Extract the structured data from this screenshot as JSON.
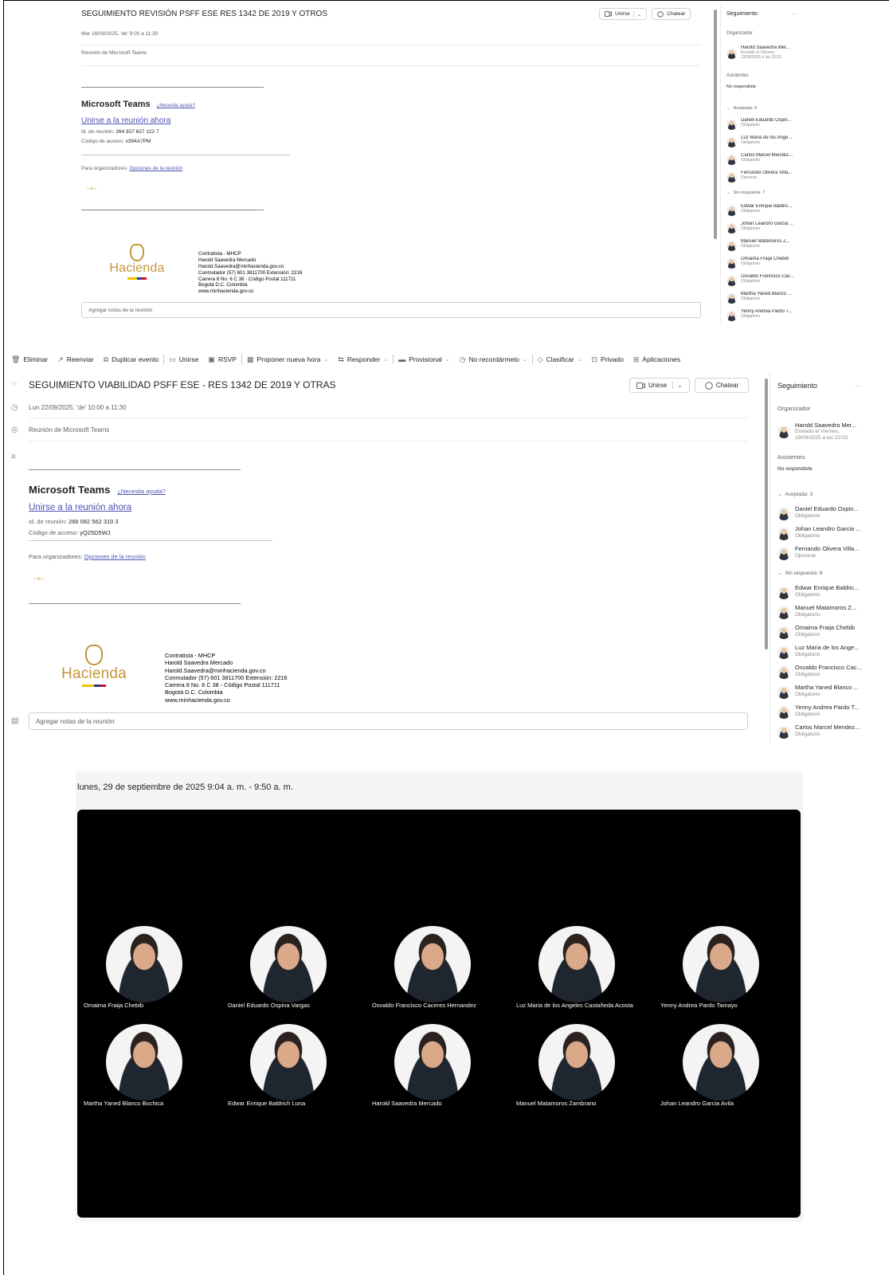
{
  "panel1": {
    "title": "SEGUIMIENTO REVISIÓN PSFF ESE RES 1342 DE 2019 Y OTROS",
    "date": "Mar 16/09/2025, 'de' 9:00 a 11:30",
    "location": "Reunión de Microsoft Teams",
    "join_label": "Unirse",
    "chat_label": "Chatear",
    "teams_heading": "Microsoft Teams",
    "help_link": "¿Necesita ayuda?",
    "join_now": "Unirse a la reunión ahora",
    "meeting_id_label": "Id. de reunión: ",
    "meeting_id": "264 927 627 122 7",
    "passcode_label": "Código de acceso: ",
    "passcode": "x394A7PM",
    "organizers_label": "Para organizadores: ",
    "options_link": "Opciones de la reunión",
    "notes_placeholder": "Agregar notas de la reunión",
    "side": {
      "title": "Seguimiento",
      "more": "···",
      "organizer_label": "Organizador",
      "organizer_name": "Harold Saavedra Mer...",
      "organizer_sent_1": "Enviado el Viernes,",
      "organizer_sent_2": "12/09/2025 a las 22:51",
      "attendees_label": "Asistentes",
      "no_response": "No respondiste",
      "accepted_label": "Aceptada: 4",
      "accepted": [
        {
          "name": "Daniel Eduardo Ospin...",
          "role": "Obligatorio"
        },
        {
          "name": "Luz Maria de los Ange...",
          "role": "Obligatorio"
        },
        {
          "name": "Carlos Marcel Mendez...",
          "role": "Obligatorio"
        },
        {
          "name": "Fernando Olivera Villa...",
          "role": "Opcional"
        }
      ],
      "noreply_label": "Sin respuesta: 7",
      "noreply": [
        {
          "name": "Edwar Enrique Baldric...",
          "role": "Obligatorio"
        },
        {
          "name": "Johan Leandro Garcia ...",
          "role": "Obligatorio"
        },
        {
          "name": "Manuel Matamoros Z...",
          "role": "Obligatorio"
        },
        {
          "name": "Omaima Fraija Chebib",
          "role": "Obligatorio"
        },
        {
          "name": "Osvaldo Francisco Cac...",
          "role": "Obligatorio"
        },
        {
          "name": "Martha Yaned Blanco ...",
          "role": "Obligatorio"
        },
        {
          "name": "Yenny Andrea Pardo T...",
          "role": "Obligatorio"
        }
      ]
    }
  },
  "signature": {
    "logo_text": "Hacienda",
    "lines": [
      "Contratista - MHCP",
      "Harold Saavedra Mercado",
      "Harold.Saavedra@minhacienda.gov.co",
      "Conmutador (57) 601 3811700 Extensión: 2216",
      "Carrera 8 No. 6 C 38 - Código Postal 111711",
      "Bogotá D.C. Colombia",
      "www.minhacienda.gov.co"
    ],
    "flag_colors": [
      "#f2c200",
      "#1c3f94",
      "#d0102a"
    ],
    "gold": "#c4953b"
  },
  "toolbar": {
    "items": [
      {
        "label": "Eliminar",
        "icon": "trash-icon",
        "chevron": false
      },
      {
        "label": "Reenviar",
        "icon": "forward-icon",
        "chevron": false
      },
      {
        "label": "Duplicar evento",
        "icon": "duplicate-icon",
        "chevron": false
      },
      {
        "label": "Unirse",
        "icon": "video-icon",
        "chevron": false
      },
      {
        "label": "RSVP",
        "icon": "rsvp-icon",
        "chevron": false
      },
      {
        "label": "Proponer nueva hora",
        "icon": "calendar-clock-icon",
        "chevron": true
      },
      {
        "label": "Responder",
        "icon": "reply-icon",
        "chevron": true
      },
      {
        "label": "Provisional",
        "icon": "tentative-icon",
        "chevron": true
      },
      {
        "label": "No recordármelo",
        "icon": "reminder-icon",
        "chevron": true
      },
      {
        "label": "Clasificar",
        "icon": "tag-icon",
        "chevron": true
      },
      {
        "label": "Privado",
        "icon": "lock-icon",
        "chevron": false
      },
      {
        "label": "Aplicaciones",
        "icon": "apps-icon",
        "chevron": false
      }
    ]
  },
  "panel2": {
    "title": "SEGUIMIENTO VIABILIDAD PSFF ESE - RES 1342 DE 2019 Y OTRAS",
    "date": "Lun 22/09/2025, 'de' 10:00 a 11:30",
    "location": "Reunión de Microsoft Teams",
    "join_label": "Unirse",
    "chat_label": "Chatear",
    "teams_heading": "Microsoft Teams",
    "help_link": "¿Necesita ayuda?",
    "join_now": "Unirse a la reunión ahora",
    "meeting_id_label": "Id. de reunión: ",
    "meeting_id": "266 082 562 310 3",
    "passcode_label": "Código de acceso: ",
    "passcode": "yQ25D5WJ",
    "organizers_label": "Para organizadores: ",
    "options_link": "Opciones de la reunión",
    "notes_placeholder": "Agregar notas de la reunión",
    "side": {
      "title": "Seguimiento",
      "more": "···",
      "organizer_label": "Organizador",
      "organizer_name": "Harold Saavedra Mer...",
      "organizer_sent_1": "Enviado el Viernes,",
      "organizer_sent_2": "19/09/2025 a las 22:03",
      "attendees_label": "Asistentes",
      "no_response": "No respondiste",
      "accepted_label": "Aceptada: 3",
      "accepted": [
        {
          "name": "Daniel Eduardo Ospin...",
          "role": "Obligatorio"
        },
        {
          "name": "Johan Leandro Garcia ...",
          "role": "Obligatorio"
        },
        {
          "name": "Fernando Olivera Villa...",
          "role": "Opcional"
        }
      ],
      "noreply_label": "Sin respuesta: 8",
      "noreply": [
        {
          "name": "Edwar Enrique Baldric...",
          "role": "Obligatorio"
        },
        {
          "name": "Manuel Matamoros Z...",
          "role": "Obligatorio"
        },
        {
          "name": "Omaima Fraija Chebib",
          "role": "Obligatorio"
        },
        {
          "name": "Luz Maria de los Ange...",
          "role": "Obligatorio"
        },
        {
          "name": "Osvaldo Francisco Cac...",
          "role": "Obligatorio"
        },
        {
          "name": "Martha Yaned Blanco ...",
          "role": "Obligatorio"
        },
        {
          "name": "Yenny Andrea Pardo T...",
          "role": "Obligatorio"
        },
        {
          "name": "Carlos Marcel Mendez...",
          "role": "Obligatorio"
        }
      ]
    }
  },
  "recording": {
    "date": "lunes, 29 de septiembre de 2025 9:04 a. m. - 9:50 a. m.",
    "participants": [
      "Omaima Fraija Chebib",
      "Daniel Eduardo Ospina Vargas",
      "Osvaldo Francisco Caceres Hernandez",
      "Luz Maria de los Angeles Castañeda Acosta",
      "Yenny Andrea Pardo Tamayo",
      "Martha Yaned Blanco Bochica",
      "Edwar Enrique Baldrich Luna",
      "Harold Saavedra Mercado",
      "Manuel Matamoros Zambrano",
      "Johan Leandro Garcia Avila"
    ]
  },
  "colors": {
    "link": "#4f52b2",
    "stage": "#000000"
  }
}
